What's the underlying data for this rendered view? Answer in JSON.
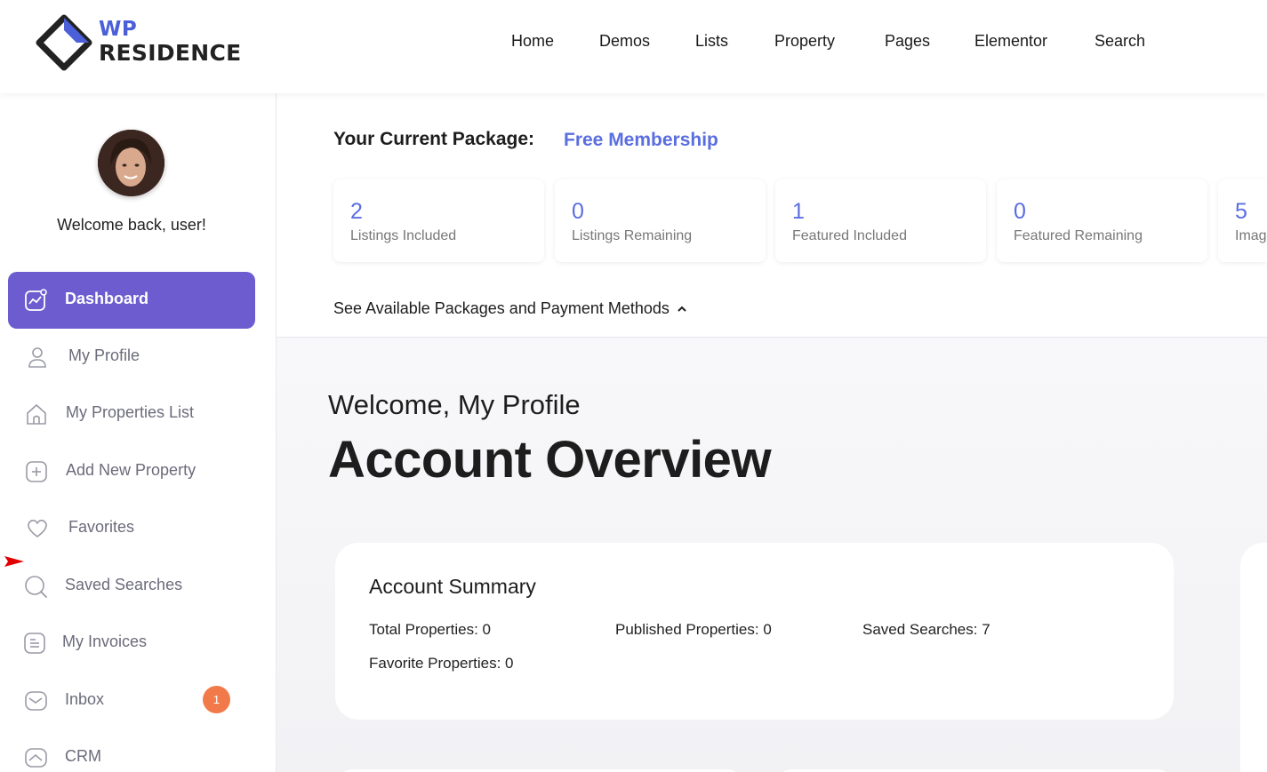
{
  "header": {
    "logo_line1": "WP",
    "logo_line2": "RESIDENCE",
    "nav": [
      "Home",
      "Demos",
      "Lists",
      "Property",
      "Pages",
      "Elementor",
      "Search"
    ]
  },
  "sidebar": {
    "welcome": "Welcome back, user!",
    "items": [
      {
        "label": "Dashboard",
        "icon": "dashboard-chart-icon",
        "active": true
      },
      {
        "label": "My Profile",
        "icon": "user-icon"
      },
      {
        "label": "My Properties List",
        "icon": "home-icon"
      },
      {
        "label": "Add New Property",
        "icon": "plus-square-icon"
      },
      {
        "label": "Favorites",
        "icon": "heart-icon"
      },
      {
        "label": "Saved Searches",
        "icon": "search-icon"
      },
      {
        "label": "My Invoices",
        "icon": "invoice-icon"
      },
      {
        "label": "Inbox",
        "icon": "mail-icon",
        "badge": "1"
      },
      {
        "label": "CRM",
        "icon": "crm-icon"
      }
    ],
    "accent_color": "#6c5ccf",
    "badge_color": "#f27a4a"
  },
  "package": {
    "title": "Your Current Package:",
    "name": "Free Membership",
    "stats": [
      {
        "value": "2",
        "label": "Listings Included"
      },
      {
        "value": "0",
        "label": "Listings Remaining"
      },
      {
        "value": "1",
        "label": "Featured Included"
      },
      {
        "value": "0",
        "label": "Featured Remaining"
      },
      {
        "value": "5",
        "label": "Images"
      }
    ],
    "link": "See Available Packages and Payment Methods"
  },
  "overview": {
    "subtitle": "Welcome, My Profile",
    "title": "Account Overview",
    "summary": {
      "heading": "Account Summary",
      "total_properties": "Total Properties: 0",
      "published_properties": "Published Properties: 0",
      "saved_searches": "Saved Searches: 7",
      "favorite_properties": "Favorite Properties: 0"
    }
  }
}
